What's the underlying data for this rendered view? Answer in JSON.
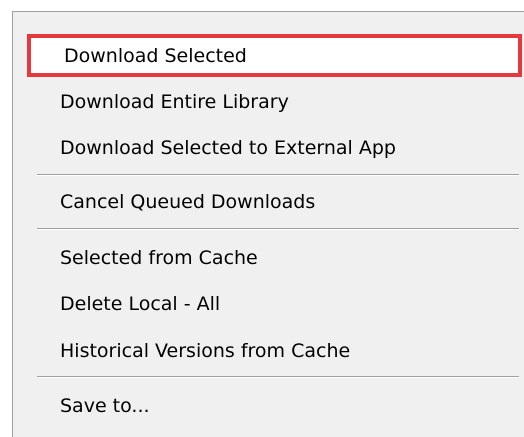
{
  "menu": {
    "items": [
      {
        "label": "Download Selected",
        "highlighted": true
      },
      {
        "label": "Download Entire Library"
      },
      {
        "label": "Download Selected to External App"
      },
      {
        "label": "Cancel Queued Downloads"
      },
      {
        "label": "Selected from Cache"
      },
      {
        "label": "Delete Local - All"
      },
      {
        "label": "Historical Versions from Cache"
      },
      {
        "label": "Save to..."
      }
    ]
  },
  "colors": {
    "menu_background": "#f0f0f0",
    "highlight_border": "#e8383d",
    "separator": "#a0a0a0"
  }
}
